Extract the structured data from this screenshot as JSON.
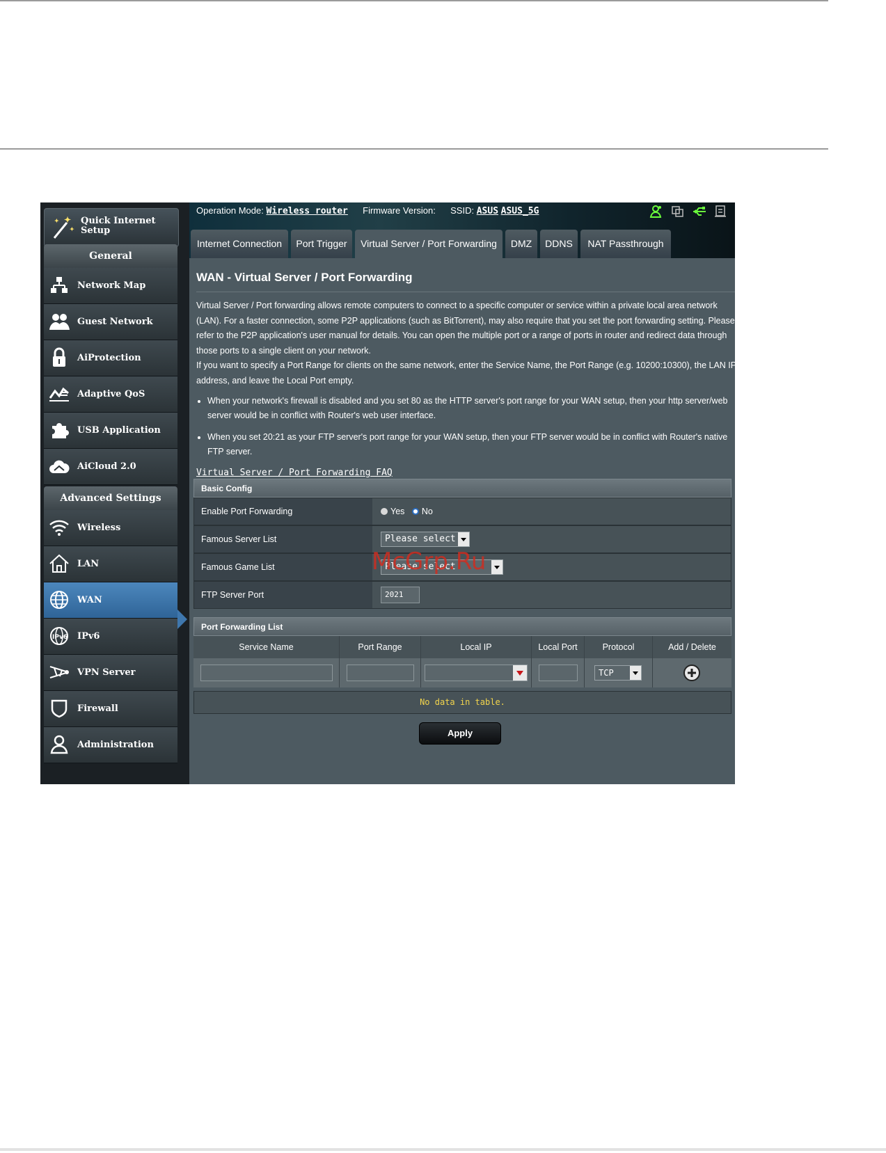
{
  "header": {
    "operation_mode_label": "Operation Mode:",
    "operation_mode_value": "Wireless router",
    "firmware_label": "Firmware Version:",
    "ssid_label": "SSID:",
    "ssid_1": "ASUS",
    "ssid_2": "ASUS_5G",
    "status_icons": [
      "users-icon",
      "copy-icon",
      "usb-icon",
      "printer-icon"
    ]
  },
  "sidebar": {
    "quick_setup": "Quick Internet Setup",
    "general_title": "General",
    "general_items": [
      {
        "label": "Network Map",
        "icon": "network-map-icon"
      },
      {
        "label": "Guest Network",
        "icon": "guest-network-icon"
      },
      {
        "label": "AiProtection",
        "icon": "lock-icon"
      },
      {
        "label": "Adaptive QoS",
        "icon": "qos-icon"
      },
      {
        "label": "USB Application",
        "icon": "puzzle-icon"
      },
      {
        "label": "AiCloud 2.0",
        "icon": "cloud-icon"
      }
    ],
    "advanced_title": "Advanced Settings",
    "advanced_items": [
      {
        "label": "Wireless",
        "icon": "wifi-icon"
      },
      {
        "label": "LAN",
        "icon": "home-icon"
      },
      {
        "label": "WAN",
        "icon": "globe-icon"
      },
      {
        "label": "IPv6",
        "icon": "ipv6-icon"
      },
      {
        "label": "VPN Server",
        "icon": "vpn-icon"
      },
      {
        "label": "Firewall",
        "icon": "shield-icon"
      },
      {
        "label": "Administration",
        "icon": "admin-icon"
      }
    ]
  },
  "tabs": [
    "Internet Connection",
    "Port Trigger",
    "Virtual Server / Port Forwarding",
    "DMZ",
    "DDNS",
    "NAT Passthrough"
  ],
  "main": {
    "title": "WAN - Virtual Server / Port Forwarding",
    "desc_1": "Virtual Server / Port forwarding allows remote computers to connect to a specific computer or service within a private local area network (LAN). For a faster connection, some P2P applications (such as BitTorrent), may also require that you set the port forwarding setting. Please refer to the P2P application's user manual for details. You can open the multiple port or a range of ports in router and redirect data through those ports to a single client on your network.",
    "desc_2": "If you want to specify a Port Range for clients on the same network, enter the Service Name, the Port Range (e.g. 10200:10300), the LAN IP address, and leave the Local Port empty.",
    "bullet_1": "When your network's firewall is disabled and you set 80 as the HTTP server's port range for your WAN setup, then your http server/web server would be in conflict with Router's web user interface.",
    "bullet_2": "When you set 20:21 as your FTP server's port range for your WAN setup, then your FTP server would be in conflict with Router's native FTP server.",
    "faq_link": "Virtual Server / Port Forwarding FAQ"
  },
  "basic_config": {
    "title": "Basic Config",
    "enable_label": "Enable Port Forwarding",
    "yes": "Yes",
    "no": "No",
    "famous_server_label": "Famous Server List",
    "famous_server_value": "Please select",
    "famous_game_label": "Famous Game List",
    "famous_game_value": "Please select",
    "ftp_label": "FTP Server Port",
    "ftp_value": "2021"
  },
  "port_list": {
    "title": "Port Forwarding List",
    "columns": [
      "Service Name",
      "Port Range",
      "Local IP",
      "Local Port",
      "Protocol",
      "Add / Delete"
    ],
    "protocol_value": "TCP",
    "empty": "No data in table."
  },
  "apply_label": "Apply",
  "watermark": "McGrp.Ru"
}
